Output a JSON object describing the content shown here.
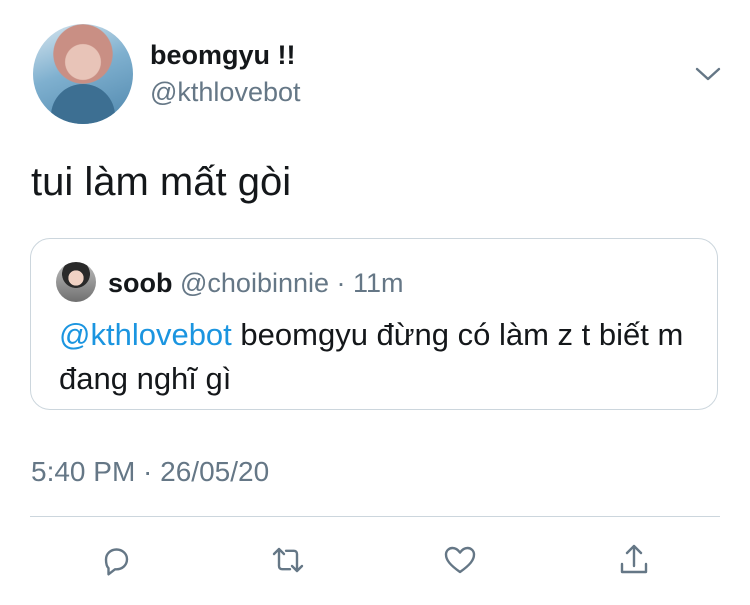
{
  "author": {
    "display_name": "beomgyu !!",
    "handle": "@kthlovebot"
  },
  "tweet": {
    "text": "tui làm mất gòi",
    "timestamp": "5:40 PM · 26/05/20"
  },
  "quoted_tweet": {
    "name": "soob",
    "meta": " @choibinnie · 11m",
    "mention": "@kthlovebot",
    "text": " beomgyu đừng có làm z t biết m đang nghĩ gì"
  },
  "icons": {
    "menu": "chevron-down-icon",
    "reply": "reply-icon",
    "retweet": "retweet-icon",
    "like": "heart-icon",
    "share": "share-icon"
  },
  "colors": {
    "accent": "#1b95e0",
    "text_primary": "#14171a",
    "text_secondary": "#657786",
    "border": "#ccd6dd"
  }
}
